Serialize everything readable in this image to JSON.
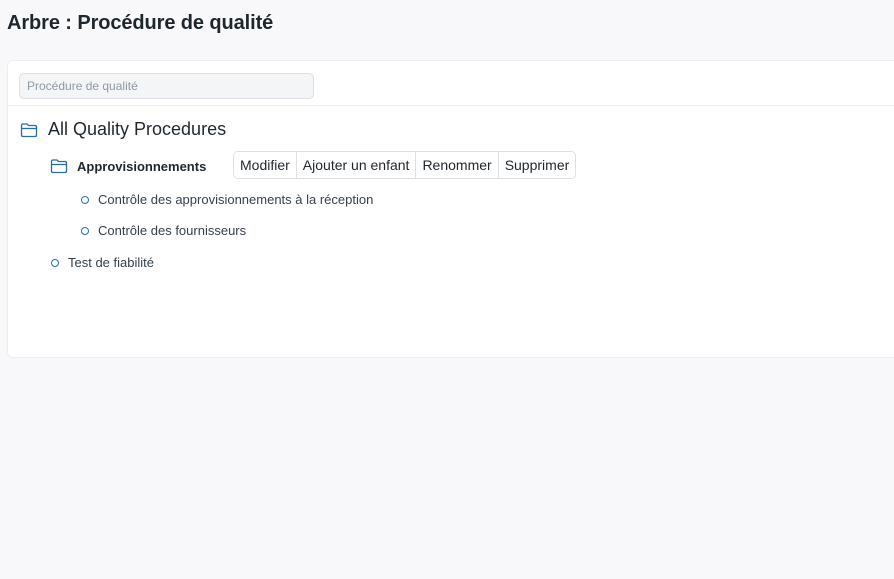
{
  "page": {
    "title": "Arbre : Procédure de qualité"
  },
  "search": {
    "placeholder": "Procédure de qualité"
  },
  "tree": {
    "root": {
      "label": "All Quality Procedures",
      "icon": "folder-open-icon"
    },
    "child": {
      "label": "Approvisionnements",
      "icon": "folder-open-icon",
      "children": [
        "Contrôle des approvisionnements à la réception",
        "Contrôle des fournisseurs"
      ]
    },
    "sibling": {
      "label": "Test de fiabilité"
    }
  },
  "actions": {
    "edit": "Modifier",
    "add_child": "Ajouter un enfant",
    "rename": "Renommer",
    "delete": "Supprimer"
  },
  "colors": {
    "accent": "#2a6bb0",
    "background": "#f8f8fa",
    "text": "#1f272e"
  }
}
